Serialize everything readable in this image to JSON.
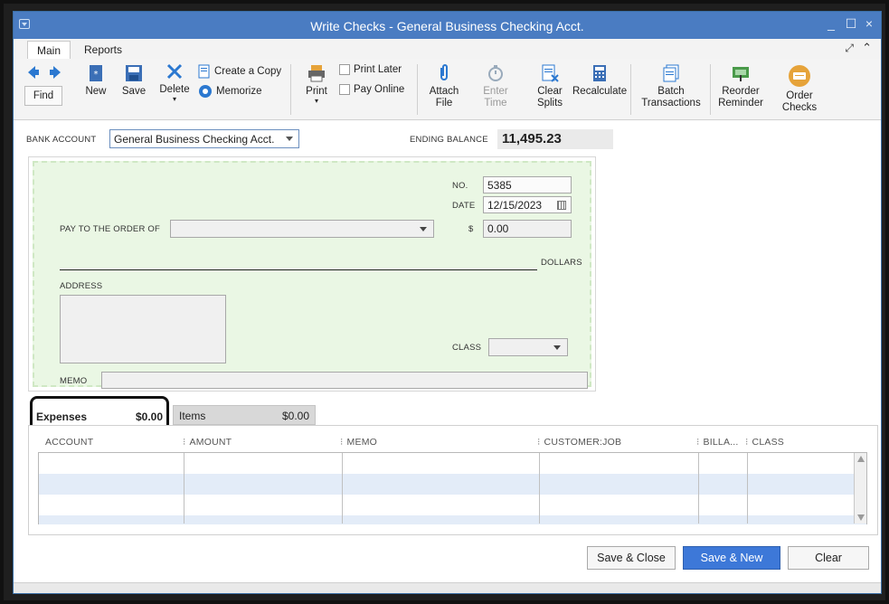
{
  "window": {
    "title": "Write Checks - General Business Checking Acct.",
    "controls": {
      "minimize": "_",
      "maximize": "☐",
      "close": "×"
    }
  },
  "menu_tabs": [
    "Main",
    "Reports"
  ],
  "ribbon": {
    "find": "Find",
    "new": "New",
    "save": "Save",
    "delete": "Delete",
    "create_copy": "Create a Copy",
    "memorize": "Memorize",
    "print": "Print",
    "print_later": "Print Later",
    "pay_online": "Pay Online",
    "attach_file": [
      "Attach",
      "File"
    ],
    "enter_time": [
      "Enter",
      "Time"
    ],
    "clear_splits": [
      "Clear",
      "Splits"
    ],
    "recalculate": "Recalculate",
    "batch_transactions": [
      "Batch",
      "Transactions"
    ],
    "reorder_reminder": [
      "Reorder",
      "Reminder"
    ],
    "order_checks": [
      "Order",
      "Checks"
    ]
  },
  "bank": {
    "label": "BANK ACCOUNT",
    "account": "General Business Checking Acct.",
    "ending_balance_label": "ENDING BALANCE",
    "ending_balance": "11,495.23"
  },
  "check": {
    "no_label": "NO.",
    "no": "5385",
    "date_label": "DATE",
    "date": "12/15/2023",
    "pay_to_label": "PAY TO THE ORDER OF",
    "payee": "",
    "amount_label": "$",
    "amount": "0.00",
    "dollars_label": "DOLLARS",
    "address_label": "ADDRESS",
    "class_label": "CLASS",
    "memo_label": "MEMO"
  },
  "detail_tabs": {
    "expenses_label": "Expenses",
    "expenses_total": "$0.00",
    "items_label": "Items",
    "items_total": "$0.00"
  },
  "grid": {
    "columns": [
      "ACCOUNT",
      "AMOUNT",
      "MEMO",
      "CUSTOMER:JOB",
      "BILLA...",
      "CLASS"
    ]
  },
  "buttons": {
    "save_close": "Save & Close",
    "save_new": "Save & New",
    "clear": "Clear"
  },
  "colors": {
    "titlebar": "#4a7cc2",
    "check_bg": "#eaf7e4",
    "primary_button": "#3d78d8"
  }
}
